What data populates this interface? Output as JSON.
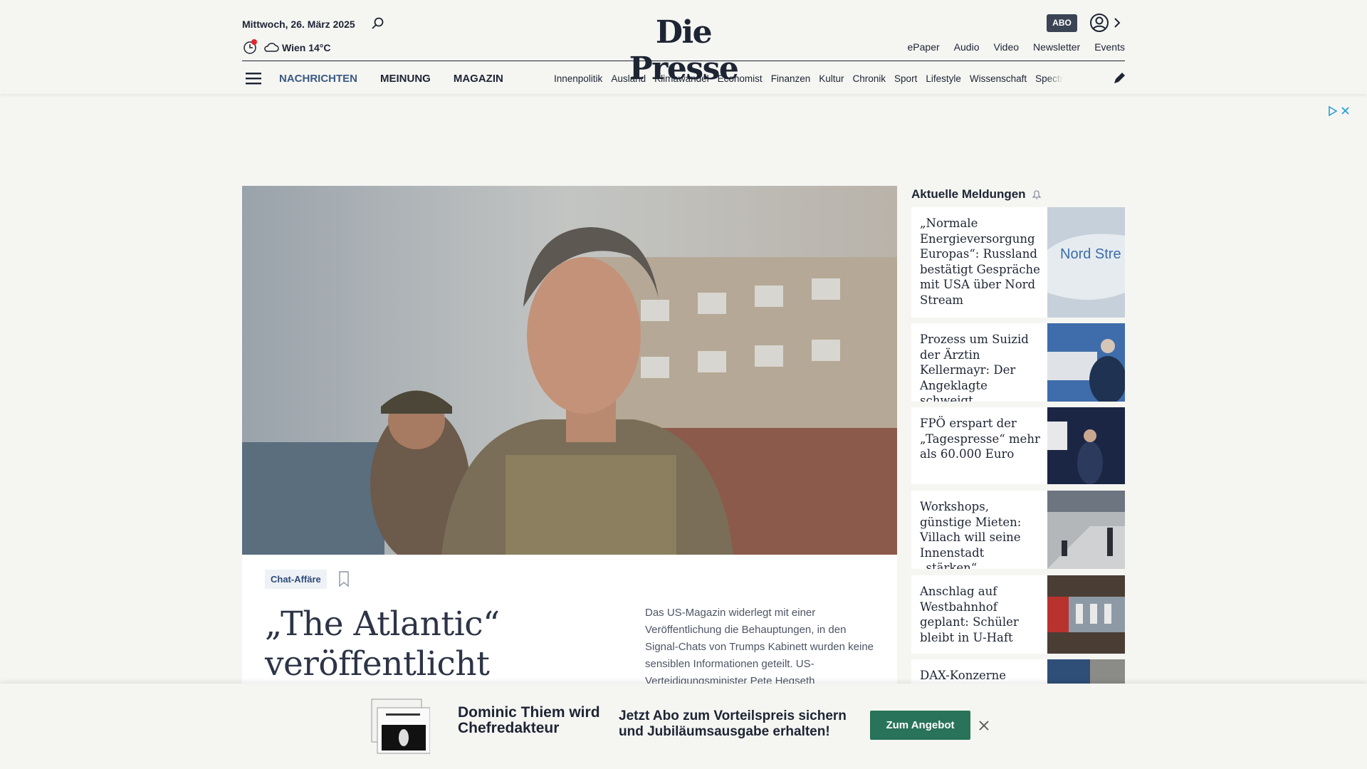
{
  "header": {
    "date": "Mittwoch, 26. März 2025",
    "weather": "Wien 14°C",
    "logo": "Die Presse",
    "abo": "ABO",
    "links": [
      "ePaper",
      "Audio",
      "Video",
      "Newsletter",
      "Events"
    ]
  },
  "nav": {
    "main": [
      "NACHRICHTEN",
      "MEINUNG",
      "MAGAZIN"
    ],
    "sub": [
      "Innenpolitik",
      "Ausland",
      "Klimawandel",
      "Economist",
      "Finanzen",
      "Kultur",
      "Chronik",
      "Sport",
      "Lifestyle",
      "Wissenschaft",
      "Spectr"
    ]
  },
  "hero": {
    "tag": "Chat-Affäre",
    "headline": "„The Atlantic“ veröffentlicht gesamten",
    "teaser": "Das US-Magazin widerlegt mit einer Veröffentlichung die Behauptungen, in den Signal-Chats von Trumps Kabinett wurden keine sensiblen Informationen geteilt. US-Verteidigungsminister Pete Hegseth"
  },
  "sidebar": {
    "title": "Aktuelle Meldungen",
    "items": [
      {
        "text": "„Normale Energieversorgung Europas“: Russland bestätigt Gespräche mit USA über Nord Stream",
        "thumb_text": "Nord Stre"
      },
      {
        "text": "Prozess um Suizid der Ärztin Kellermayr: Der Angeklagte schweigt"
      },
      {
        "text": "FPÖ erspart der „Tagespresse“ mehr als 60.000 Euro"
      },
      {
        "text": "Workshops, günstige Mieten: Villach will seine Innenstadt „stärken“"
      },
      {
        "text": "Anschlag auf Westbahnhof geplant: Schüler bleibt in U-Haft"
      },
      {
        "text": "DAX-Konzerne bauen"
      }
    ]
  },
  "banner": {
    "left": "Dominic Thiem wird Chefredakteur",
    "mid": "Jetzt Abo zum Vorteilspreis sichern und Jubiläumsausgabe erhalten!",
    "button": "Zum Angebot"
  },
  "colors": {
    "background": "#f5f5f2",
    "text": "#1d2433",
    "nav_active": "#3b5a84",
    "cta": "#28735a",
    "tag_bg": "#eef1f6"
  }
}
